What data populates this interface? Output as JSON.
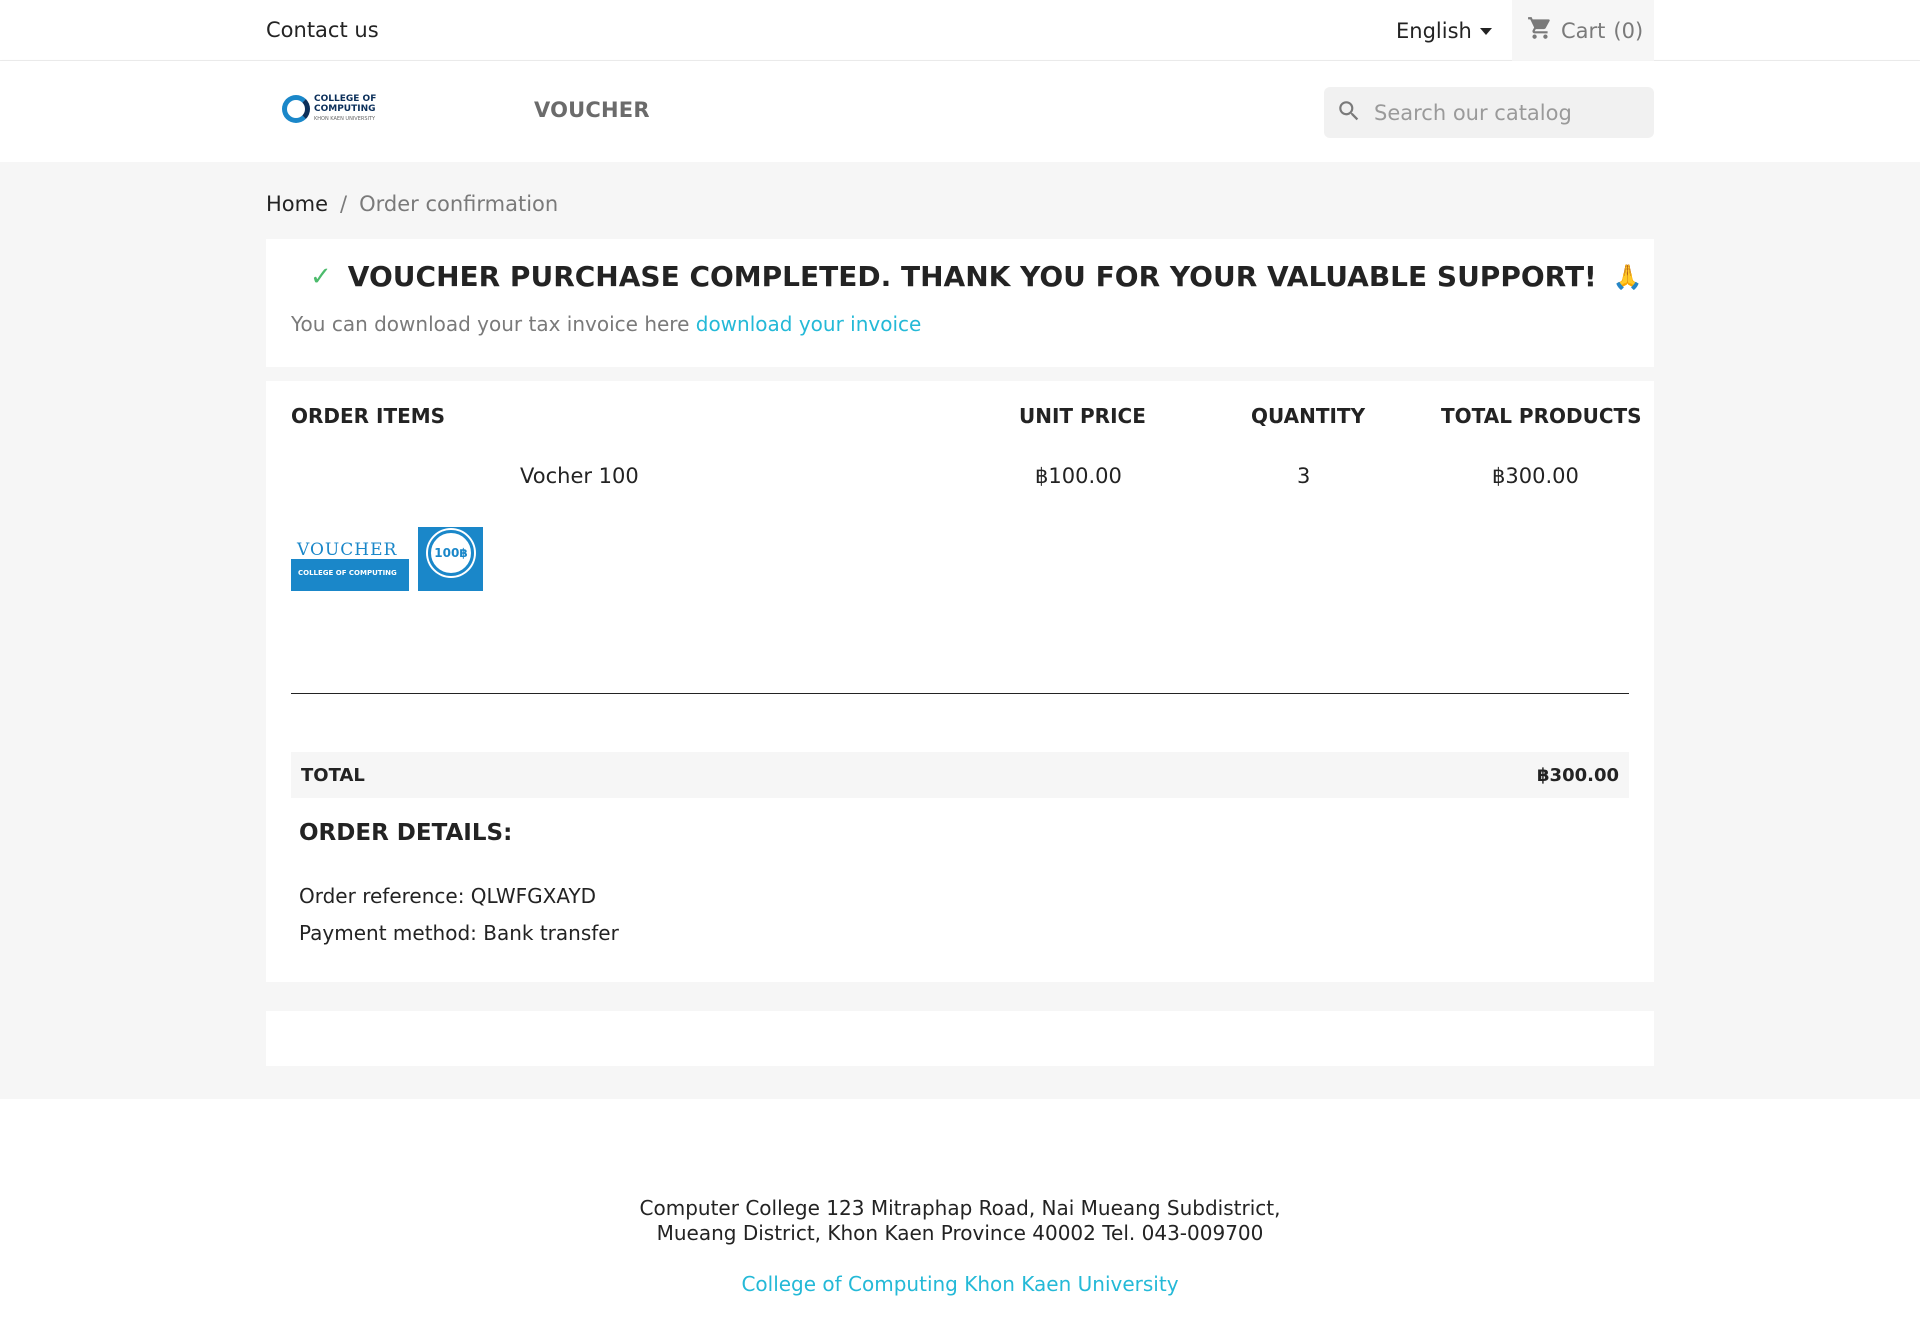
{
  "topnav": {
    "contact": "Contact us",
    "language": "English",
    "cart_label": "Cart",
    "cart_count": "(0)"
  },
  "header": {
    "logo_line1": "COLLEGE OF",
    "logo_line2": "COMPUTING",
    "logo_sub": "KHON KAEN UNIVERSITY",
    "menu_voucher": "VOUCHER",
    "search_placeholder": "Search our catalog"
  },
  "breadcrumb": {
    "home": "Home",
    "separator": "/",
    "current": "Order confirmation"
  },
  "confirmation": {
    "title": "VOUCHER PURCHASE COMPLETED. THANK YOU FOR YOUR VALUABLE SUPPORT!",
    "emoji": "🙏",
    "invoice_text": "You can download your tax invoice here",
    "invoice_link": "download your invoice"
  },
  "order_items": {
    "headers": {
      "items": "ORDER ITEMS",
      "unit_price": "UNIT PRICE",
      "quantity": "QUANTITY",
      "total_products": "TOTAL PRODUCTS"
    },
    "rows": [
      {
        "name": "Vocher 100",
        "unit_price": "฿100.00",
        "quantity": "3",
        "total": "฿300.00"
      }
    ],
    "image": {
      "word": "VOUCHER",
      "college": "COLLEGE OF COMPUTING",
      "badge": "100฿"
    }
  },
  "total": {
    "label": "TOTAL",
    "value": "฿300.00"
  },
  "order_details": {
    "title": "ORDER DETAILS:",
    "reference": "Order reference: QLWFGXAYD",
    "payment": "Payment method: Bank transfer"
  },
  "footer": {
    "address_line1": "Computer College 123 Mitraphap Road, Nai Mueang Subdistrict,",
    "address_line2": "Mueang District, Khon Kaen Province 40002 Tel. 043-009700",
    "link": "College of Computing Khon Kaen University"
  },
  "colors": {
    "accent": "#24b9d7",
    "check": "#4cbb6c",
    "brand_blue": "#1a87c9",
    "background": "#f6f6f6"
  }
}
